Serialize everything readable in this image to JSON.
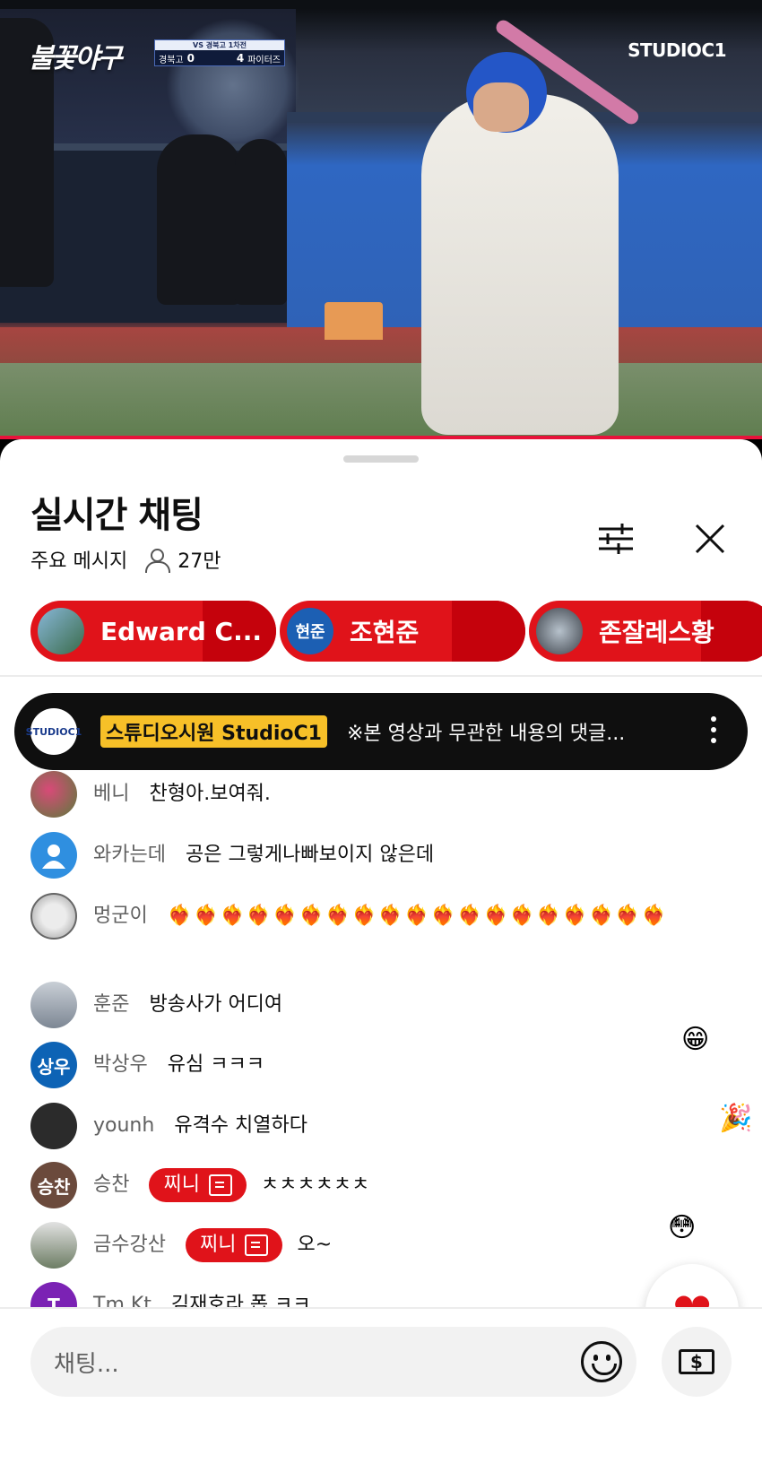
{
  "video": {
    "logo_text": "불꽃야구",
    "score_header": "VS 경북고 1차전",
    "team_a": "경북고",
    "score_a": "0",
    "team_b": "파이터즈",
    "score_b": "4",
    "channel_watermark": "STUDIOC1"
  },
  "chat_panel": {
    "title": "실시간 채팅",
    "mode_label": "주요 메시지",
    "viewer_count": "27만"
  },
  "supporters": [
    {
      "name": "Edward C...",
      "avatar_color": "#4b7fa7",
      "avatar_text": ""
    },
    {
      "name": "조현준",
      "avatar_color": "#1c5fb3",
      "avatar_text": "현준"
    },
    {
      "name": "존잘레스황",
      "avatar_color": "#3b4048",
      "avatar_text": ""
    }
  ],
  "pinned": {
    "avatar_text": "STUDIOC1",
    "channel": "스튜디오시원 StudioC1",
    "message": "※본 영상과 무관한 내용의 댓글..."
  },
  "messages": [
    {
      "author": "베니",
      "text": "찬형아.보여줘.",
      "avatar_color": "#6e7e46",
      "avatar_text": ""
    },
    {
      "author": "와카는데",
      "text": "공은 그렇게나빠보이지 않은데",
      "avatar_color": "#2f8fe0",
      "avatar_text": ""
    },
    {
      "author": "멍군이",
      "text": "❤️‍🔥❤️‍🔥❤️‍🔥❤️‍🔥❤️‍🔥❤️‍🔥❤️‍🔥❤️‍🔥❤️‍🔥❤️‍🔥❤️‍🔥❤️‍🔥❤️‍🔥❤️‍🔥❤️‍🔥❤️‍🔥❤️‍🔥❤️‍🔥❤️‍🔥",
      "avatar_color": "#b9b9b9",
      "avatar_text": ""
    },
    {
      "author": "훈준",
      "text": "방송사가 어디여",
      "avatar_color": "#9aa5b2",
      "avatar_text": ""
    },
    {
      "author": "박상우",
      "text": "유심 ㅋㅋㅋ",
      "avatar_color": "#0d63b5",
      "avatar_text": "상우"
    },
    {
      "author": "younh",
      "text": "유격수 치열하다",
      "avatar_color": "#2b2b2b",
      "avatar_text": ""
    },
    {
      "author": "승찬",
      "member_badge": "찌니",
      "text": "ㅊㅊㅊㅊㅊㅊ",
      "avatar_color": "#6b4a3c",
      "avatar_text": "승찬"
    },
    {
      "author": "금수강산",
      "member_badge": "찌니",
      "text": "오~",
      "avatar_color": "#7a8a72",
      "avatar_text": ""
    },
    {
      "author": "Tm Kt",
      "text": "김재호라 폽 ㅋㅋ",
      "avatar_color": "#7b22b4",
      "avatar_text": "T"
    }
  ],
  "reactions": [
    "😁",
    "🎉",
    "😳"
  ],
  "like_icon": "heart-icon",
  "input": {
    "placeholder": "채팅...",
    "money_label": "$"
  }
}
